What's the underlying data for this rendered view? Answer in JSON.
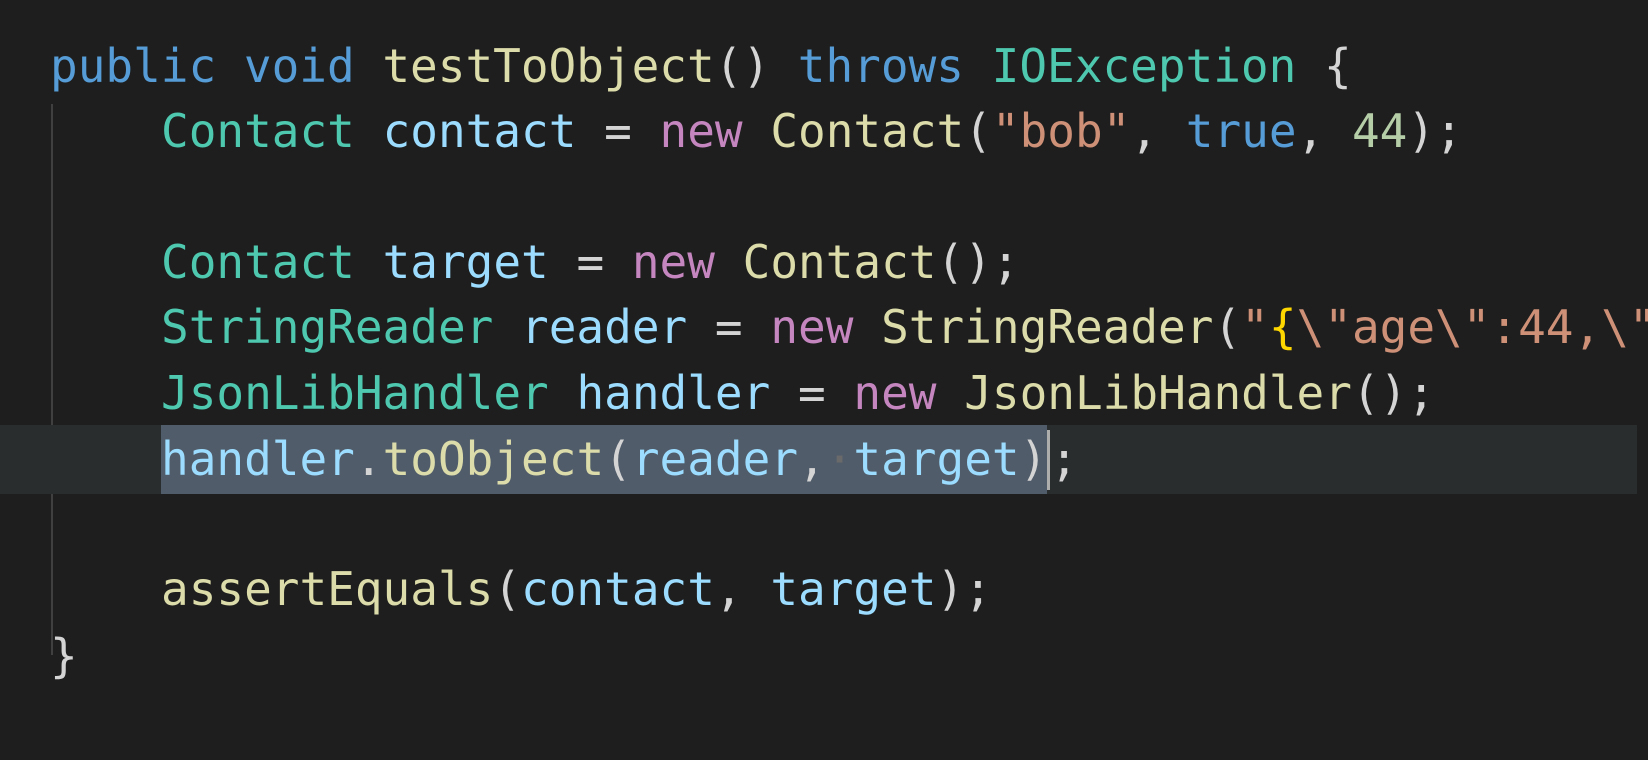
{
  "editor": {
    "language": "java",
    "lines": [
      {
        "id": "method-signature",
        "tokens": [
          {
            "type": "kw",
            "text": "public"
          },
          {
            "type": "punc",
            "text": " "
          },
          {
            "type": "kw",
            "text": "void"
          },
          {
            "type": "punc",
            "text": " "
          },
          {
            "type": "fn",
            "text": "testToObject"
          },
          {
            "type": "punc",
            "text": "() "
          },
          {
            "type": "kw",
            "text": "throws"
          },
          {
            "type": "punc",
            "text": " "
          },
          {
            "type": "typ",
            "text": "IOException"
          },
          {
            "type": "punc",
            "text": " {"
          }
        ]
      },
      {
        "id": "contact-declaration",
        "tokens": [
          {
            "type": "typ",
            "text": "Contact"
          },
          {
            "type": "punc",
            "text": " "
          },
          {
            "type": "var",
            "text": "contact"
          },
          {
            "type": "punc",
            "text": " = "
          },
          {
            "type": "new",
            "text": "new"
          },
          {
            "type": "punc",
            "text": " "
          },
          {
            "type": "fn",
            "text": "Contact"
          },
          {
            "type": "punc",
            "text": "("
          },
          {
            "type": "str",
            "text": "\"bob\""
          },
          {
            "type": "punc",
            "text": ", "
          },
          {
            "type": "kw",
            "text": "true"
          },
          {
            "type": "punc",
            "text": ", "
          },
          {
            "type": "num",
            "text": "44"
          },
          {
            "type": "punc",
            "text": ");"
          }
        ]
      },
      {
        "id": "blank-1",
        "tokens": []
      },
      {
        "id": "target-declaration",
        "tokens": [
          {
            "type": "typ",
            "text": "Contact"
          },
          {
            "type": "punc",
            "text": " "
          },
          {
            "type": "var",
            "text": "target"
          },
          {
            "type": "punc",
            "text": " = "
          },
          {
            "type": "new",
            "text": "new"
          },
          {
            "type": "punc",
            "text": " "
          },
          {
            "type": "fn",
            "text": "Contact"
          },
          {
            "type": "punc",
            "text": "();"
          }
        ]
      },
      {
        "id": "reader-declaration",
        "tokens": [
          {
            "type": "typ",
            "text": "StringReader"
          },
          {
            "type": "punc",
            "text": " "
          },
          {
            "type": "var",
            "text": "reader"
          },
          {
            "type": "punc",
            "text": " = "
          },
          {
            "type": "new",
            "text": "new"
          },
          {
            "type": "punc",
            "text": " "
          },
          {
            "type": "fn",
            "text": "StringReader"
          },
          {
            "type": "punc",
            "text": "("
          },
          {
            "type": "str",
            "text": "\""
          },
          {
            "type": "brk",
            "text": "{"
          },
          {
            "type": "str",
            "text": "\\\"age\\\":44,\\\""
          }
        ]
      },
      {
        "id": "handler-declaration",
        "tokens": [
          {
            "type": "typ",
            "text": "JsonLibHandler"
          },
          {
            "type": "punc",
            "text": " "
          },
          {
            "type": "var",
            "text": "handler"
          },
          {
            "type": "punc",
            "text": " = "
          },
          {
            "type": "new",
            "text": "new"
          },
          {
            "type": "punc",
            "text": " "
          },
          {
            "type": "fn",
            "text": "JsonLibHandler"
          },
          {
            "type": "punc",
            "text": "();"
          }
        ]
      },
      {
        "id": "to-object-call",
        "current": true,
        "selected_tokens": [
          {
            "type": "var",
            "text": "handler"
          },
          {
            "type": "punc",
            "text": "."
          },
          {
            "type": "fn",
            "text": "toObject"
          },
          {
            "type": "punc",
            "text": "("
          },
          {
            "type": "var",
            "text": "reader"
          },
          {
            "type": "punc",
            "text": ","
          },
          {
            "type": "ws",
            "text": "·"
          },
          {
            "type": "var",
            "text": "target"
          },
          {
            "type": "punc",
            "text": ")"
          }
        ],
        "tokens": [
          {
            "type": "punc",
            "text": ";"
          }
        ]
      },
      {
        "id": "blank-2",
        "tokens": []
      },
      {
        "id": "assert-call",
        "tokens": [
          {
            "type": "fn",
            "text": "assertEquals"
          },
          {
            "type": "punc",
            "text": "("
          },
          {
            "type": "var",
            "text": "contact"
          },
          {
            "type": "punc",
            "text": ", "
          },
          {
            "type": "var",
            "text": "target"
          },
          {
            "type": "punc",
            "text": ");"
          }
        ]
      },
      {
        "id": "method-close",
        "tokens": [
          {
            "type": "punc",
            "text": "}"
          }
        ]
      }
    ]
  },
  "colors": {
    "background": "#1e1e1e",
    "keyword": "#569cd6",
    "type": "#4ec9b0",
    "variable": "#9cdcfe",
    "function": "#dcdcaa",
    "new_keyword": "#c586c0",
    "string": "#ce9178",
    "number": "#b5cea8",
    "selection": "#515c6a",
    "current_line": "#2a2d2e"
  }
}
